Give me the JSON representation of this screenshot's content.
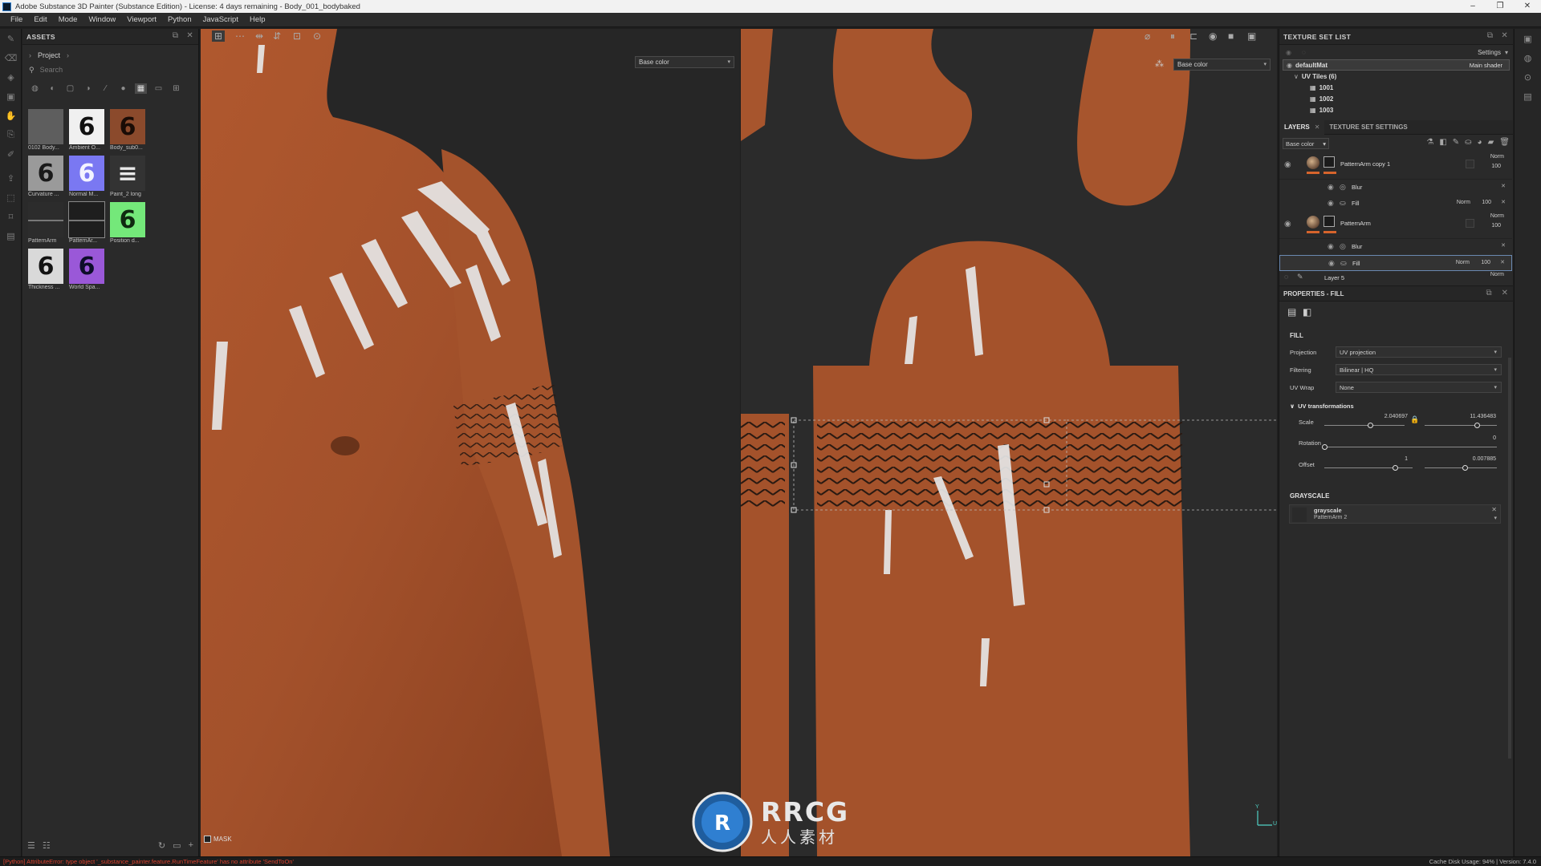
{
  "window": {
    "title": "Adobe Substance 3D Painter (Substance Edition) - License: 4 days remaining - Body_001_bodybaked",
    "controls": [
      "–",
      "❐",
      "✕"
    ]
  },
  "menu": [
    "File",
    "Edit",
    "Mode",
    "Window",
    "Viewport",
    "Python",
    "JavaScript",
    "Help"
  ],
  "assets": {
    "title": "ASSETS",
    "breadcrumb": "Project",
    "search_placeholder": "Search",
    "items": [
      {
        "label": "0102 Body...",
        "glyph": "",
        "bg": "#5e5e5e",
        "fg": "#c98e6a"
      },
      {
        "label": "Ambient O...",
        "glyph": "6",
        "bg": "#f0f0f0",
        "fg": "#111111"
      },
      {
        "label": "Body_sub0...",
        "glyph": "6",
        "bg": "#8b4a2c",
        "fg": "#1a0c06"
      },
      {
        "label": "Curvature ...",
        "glyph": "6",
        "bg": "#9a9a9a",
        "fg": "#1a1a1a"
      },
      {
        "label": "Normal M...",
        "glyph": "6",
        "bg": "#7a78f2",
        "fg": "#f3f3ff"
      },
      {
        "label": "Paint_2 long",
        "glyph": "≡",
        "bg": "#333333",
        "fg": "#e8e8e8"
      },
      {
        "label": "PatternArm",
        "glyph": "",
        "bg": "#2c2c2c",
        "fg": "#777777"
      },
      {
        "label": "PatternAr...",
        "glyph": "",
        "bg": "#1e1e1e",
        "fg": "#777777"
      },
      {
        "label": "Position d...",
        "glyph": "6",
        "bg": "#74e87a",
        "fg": "#0f2a10"
      },
      {
        "label": "Thickness ...",
        "glyph": "6",
        "bg": "#d9d9d9",
        "fg": "#121212"
      },
      {
        "label": "World Spa...",
        "glyph": "6",
        "bg": "#9a58d8",
        "fg": "#0d0d2a"
      }
    ]
  },
  "viewport": {
    "left_channel": "Base color",
    "right_channel": "Base color",
    "mask_label": "MASK",
    "axis_y": "Y",
    "axis_u": "U"
  },
  "texture_set_list": {
    "title": "TEXTURE SET LIST",
    "settings_label": "Settings",
    "set_name": "defaultMat",
    "shader": "Main shader",
    "uv_tiles": "UV Tiles (6)",
    "tiles": [
      "1001",
      "1002",
      "1003"
    ]
  },
  "layers_panel": {
    "tab_layers": "LAYERS",
    "tab_settings": "TEXTURE SET SETTINGS",
    "channel": "Base color",
    "layers": [
      {
        "name": "PatternArm copy 1",
        "blend": "Norm",
        "opacity": "100",
        "effects": [
          {
            "name": "Blur",
            "blend": "",
            "opacity": ""
          },
          {
            "name": "Fill",
            "blend": "Norm",
            "opacity": "100"
          }
        ]
      },
      {
        "name": "PatternArm",
        "blend": "Norm",
        "opacity": "100",
        "effects": [
          {
            "name": "Blur",
            "blend": "",
            "opacity": ""
          },
          {
            "name": "Fill",
            "blend": "Norm",
            "opacity": "100"
          }
        ]
      }
    ],
    "last_layer": {
      "name": "Layer 5",
      "blend": "Norm"
    }
  },
  "properties": {
    "title": "PROPERTIES - FILL",
    "section_fill": "FILL",
    "projection_label": "Projection",
    "projection_value": "UV projection",
    "filtering_label": "Filtering",
    "filtering_value": "Bilinear | HQ",
    "uvwrap_label": "UV Wrap",
    "uvwrap_value": "None",
    "uv_transform_title": "UV transformations",
    "scale_label": "Scale",
    "scale_u": "2.040697",
    "scale_v": "11.436483",
    "rotation_label": "Rotation",
    "rotation_value": "0",
    "offset_label": "Offset",
    "offset_u": "1",
    "offset_v": "0.007885",
    "section_grayscale": "GRAYSCALE",
    "grayscale_name": "grayscale",
    "grayscale_source": "PatternArm 2"
  },
  "status": {
    "error": "[Python] AttributeError: type object '_substance_painter.feature.RunTimeFeature' has no attribute 'SendToOn'",
    "info": "Cache Disk Usage:   94%  |  Version: 7.4.0"
  },
  "watermark": {
    "brand": "RRCG",
    "sub": "人人素材"
  }
}
